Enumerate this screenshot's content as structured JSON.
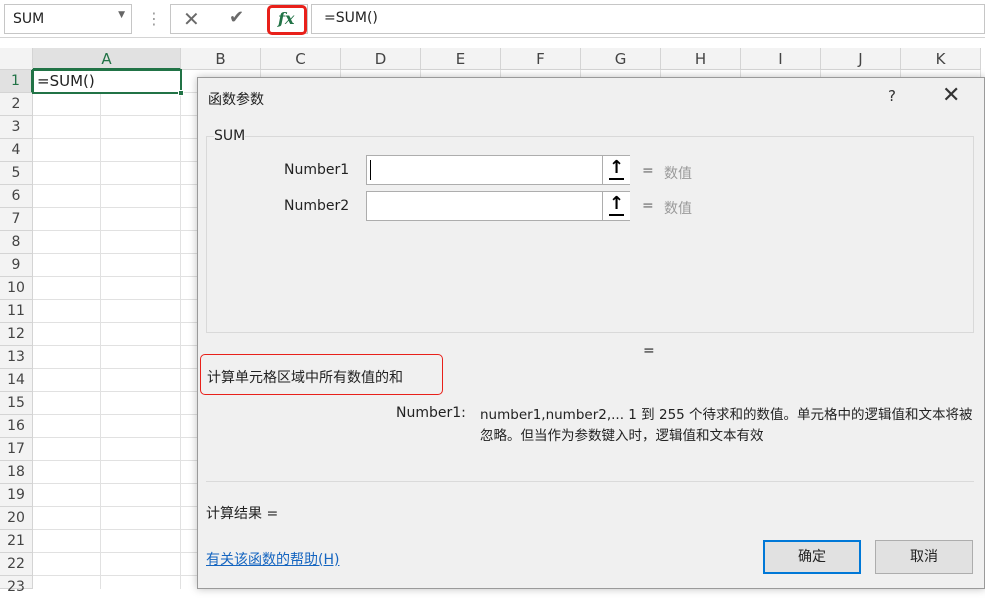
{
  "formula_bar": {
    "name_box": "SUM",
    "formula": "=SUM()",
    "fx_label": "fx"
  },
  "grid": {
    "columns": [
      "A",
      "B",
      "C",
      "D",
      "E",
      "F",
      "G",
      "H",
      "I",
      "J",
      "K"
    ],
    "rows": [
      "1",
      "2",
      "3",
      "4",
      "5",
      "6",
      "7",
      "8",
      "9",
      "10",
      "11",
      "12",
      "13",
      "14",
      "15",
      "16",
      "17",
      "18",
      "19",
      "20",
      "21",
      "22",
      "23"
    ],
    "active_cell_value": "=SUM()"
  },
  "dialog": {
    "title": "函数参数",
    "help": "?",
    "close": "✕",
    "function_name": "SUM",
    "args": [
      {
        "label": "Number1",
        "value": "",
        "eq": "=",
        "hint": "数值"
      },
      {
        "label": "Number2",
        "value": "",
        "eq": "=",
        "hint": "数值"
      }
    ],
    "result_eq": "=",
    "description": "计算单元格区域中所有数值的和",
    "arg_desc_name": "Number1:",
    "arg_desc_text": "number1,number2,... 1 到 255 个待求和的数值。单元格中的逻辑值和文本将被忽略。但当作为参数键入时，逻辑值和文本有效",
    "calc_result": "计算结果 =",
    "help_link": "有关该函数的帮助(H)",
    "ok": "确定",
    "cancel": "取消"
  },
  "colors": {
    "accent_green": "#217346",
    "highlight_red": "#e8201a",
    "link_blue": "#1565c0",
    "primary_border": "#0078d7"
  }
}
